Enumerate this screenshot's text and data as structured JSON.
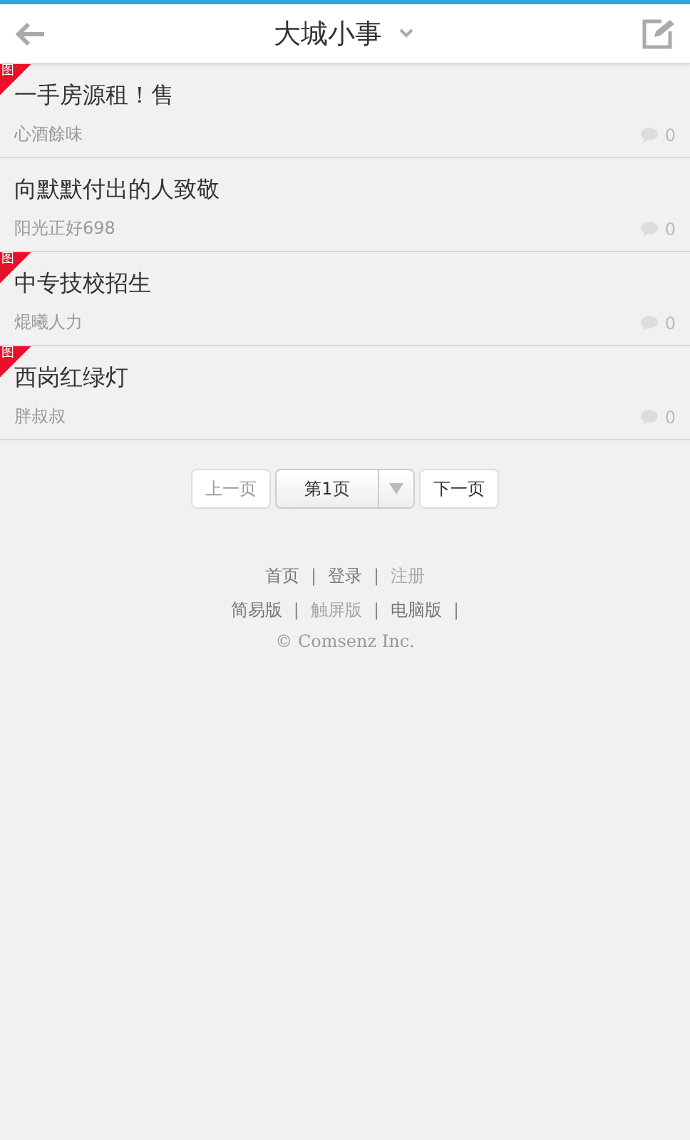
{
  "header": {
    "title": "大城小事"
  },
  "threads": [
    {
      "badge": "图",
      "title": "一手房源租！售",
      "author": "心酒餘味",
      "replies": "0"
    },
    {
      "title": "向默默付出的人致敬",
      "author": "阳光正好698",
      "replies": "0"
    },
    {
      "badge": "图",
      "title": "中专技校招生",
      "author": "焜曦人力",
      "replies": "0"
    },
    {
      "badge": "图",
      "title": "西岗红绿灯",
      "author": "胖叔叔",
      "replies": "0"
    }
  ],
  "pagination": {
    "prev": "上一页",
    "page": "第1页",
    "next": "下一页"
  },
  "footer": {
    "lines": [
      [
        {
          "label": "首页",
          "muted": false,
          "sep": "|"
        },
        {
          "label": "登录",
          "muted": false,
          "sep": "|"
        },
        {
          "label": "注册",
          "muted": true
        }
      ],
      [
        {
          "label": "简易版",
          "muted": false,
          "sep": "|"
        },
        {
          "label": "触屏版",
          "muted": true,
          "sep": "|"
        },
        {
          "label": "电脑版",
          "muted": false,
          "sep": "|"
        }
      ]
    ],
    "copyright": "© Comsenz Inc."
  }
}
